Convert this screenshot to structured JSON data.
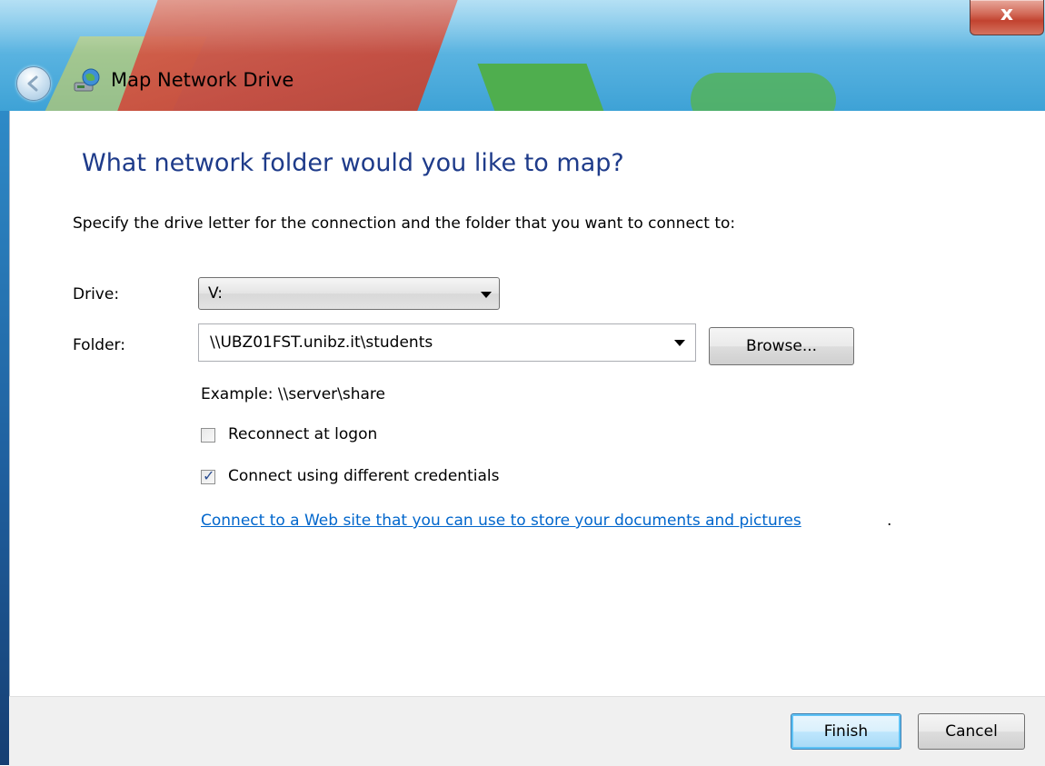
{
  "window": {
    "title": "Map Network Drive",
    "close_glyph": "x"
  },
  "heading": "What network folder would you like to map?",
  "instructions": "Specify the drive letter for the connection and the folder that you want to connect to:",
  "drive": {
    "label": "Drive:",
    "value": "V:"
  },
  "folder": {
    "label": "Folder:",
    "value": "\\\\UBZ01FST.unibz.it\\students",
    "browse_label": "Browse..."
  },
  "example": "Example: \\\\server\\share",
  "options": {
    "reconnect": {
      "label": "Reconnect at logon",
      "checked": false
    },
    "credentials": {
      "label": "Connect using different credentials",
      "checked": true
    }
  },
  "link": {
    "text": "Connect to a Web site that you can use to store your documents and pictures",
    "suffix": "."
  },
  "footer": {
    "finish_label": "Finish",
    "cancel_label": "Cancel"
  },
  "icons": {
    "back": "back-arrow-icon",
    "app": "network-drive-icon",
    "dropdown": "chevron-down-icon",
    "close": "close-icon",
    "check": "checkmark-icon"
  },
  "colors": {
    "heading": "#1e3b8a",
    "link": "#0066cc",
    "titlebar": "#3ea2d6",
    "close_button": "#c24330"
  }
}
